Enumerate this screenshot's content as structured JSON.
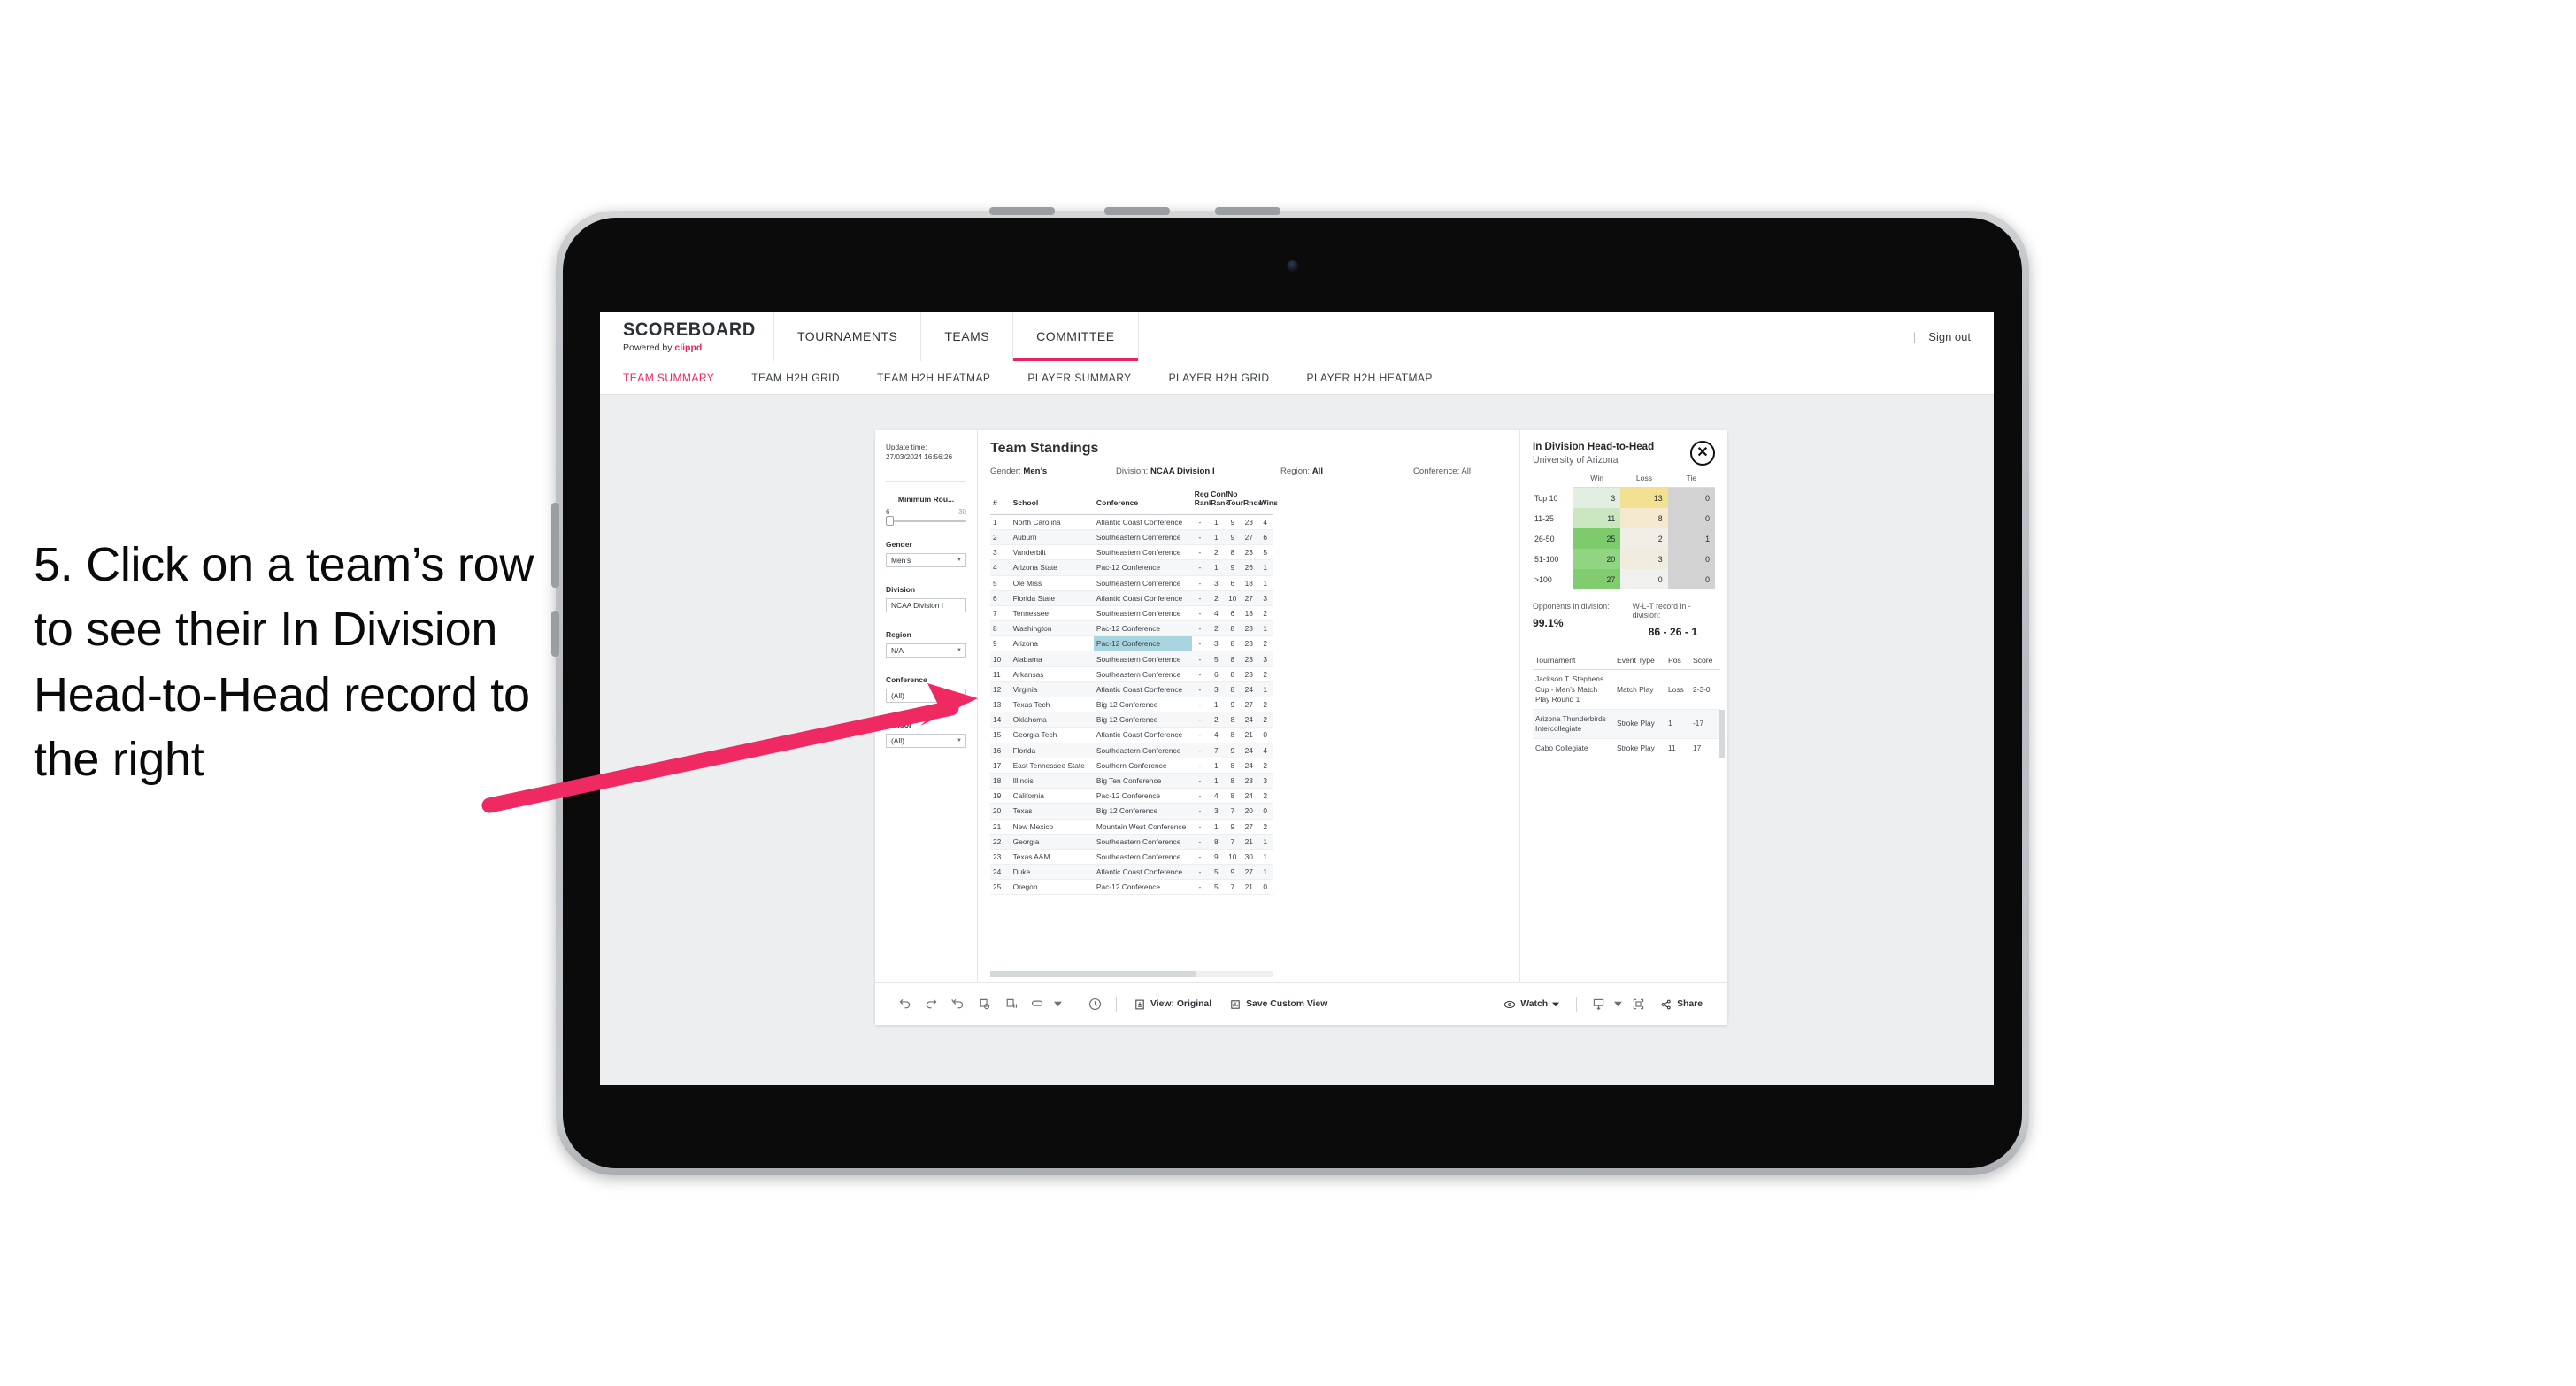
{
  "annotation": {
    "text": "5. Click on a team’s row to see their In Division Head-to-Head record to the right",
    "arrow_color": "#ef2a63"
  },
  "app": {
    "brand": {
      "title": "SCOREBOARD",
      "sub_prefix": "Powered by ",
      "sub_brand": "clippd"
    },
    "topnav": [
      {
        "label": "TOURNAMENTS",
        "active": false
      },
      {
        "label": "TEAMS",
        "active": false
      },
      {
        "label": "COMMITTEE",
        "active": true
      }
    ],
    "topbar_right": {
      "divider": "|",
      "sign_out": "Sign out"
    },
    "subnav": [
      {
        "label": "TEAM SUMMARY",
        "active": true
      },
      {
        "label": "TEAM H2H GRID",
        "active": false
      },
      {
        "label": "TEAM H2H HEATMAP",
        "active": false
      },
      {
        "label": "PLAYER SUMMARY",
        "active": false
      },
      {
        "label": "PLAYER H2H GRID",
        "active": false
      },
      {
        "label": "PLAYER H2H HEATMAP",
        "active": false
      }
    ],
    "accent_color": "#e8245c"
  },
  "filters": {
    "update_label": "Update time:",
    "update_value": "27/03/2024 16:56:26",
    "min_rounds": {
      "title": "Minimum Rou...",
      "min": "6",
      "max": "30"
    },
    "gender": {
      "title": "Gender",
      "value": "Men’s"
    },
    "division": {
      "title": "Division",
      "value": "NCAA Division I"
    },
    "region": {
      "title": "Region",
      "value": "N/A"
    },
    "conference": {
      "title": "Conference",
      "value": "(All)"
    },
    "school": {
      "title": "School",
      "value": "(All)"
    }
  },
  "standings": {
    "title": "Team Standings",
    "meta": {
      "gender_label": "Gender:",
      "gender_value": "Men’s",
      "division_label": "Division:",
      "division_value": "NCAA Division I",
      "region_label": "Region:",
      "region_value": "All",
      "conference_label": "Conference:",
      "conference_value": "All"
    },
    "columns": [
      "#",
      "School",
      "Conference",
      "Reg Rank",
      "Conf Rank",
      "No Tour",
      "Rnds",
      "Wins"
    ],
    "highlighted_row_index": 8,
    "rows": [
      {
        "rank": "1",
        "school": "North Carolina",
        "conference": "Atlantic Coast Conference",
        "reg_rank": "-",
        "conf_rank": "1",
        "no_tour": "9",
        "rnds": "23",
        "wins": "4"
      },
      {
        "rank": "2",
        "school": "Auburn",
        "conference": "Southeastern Conference",
        "reg_rank": "-",
        "conf_rank": "1",
        "no_tour": "9",
        "rnds": "27",
        "wins": "6"
      },
      {
        "rank": "3",
        "school": "Vanderbilt",
        "conference": "Southeastern Conference",
        "reg_rank": "-",
        "conf_rank": "2",
        "no_tour": "8",
        "rnds": "23",
        "wins": "5"
      },
      {
        "rank": "4",
        "school": "Arizona State",
        "conference": "Pac-12 Conference",
        "reg_rank": "-",
        "conf_rank": "1",
        "no_tour": "9",
        "rnds": "26",
        "wins": "1"
      },
      {
        "rank": "5",
        "school": "Ole Miss",
        "conference": "Southeastern Conference",
        "reg_rank": "-",
        "conf_rank": "3",
        "no_tour": "6",
        "rnds": "18",
        "wins": "1"
      },
      {
        "rank": "6",
        "school": "Florida State",
        "conference": "Atlantic Coast Conference",
        "reg_rank": "-",
        "conf_rank": "2",
        "no_tour": "10",
        "rnds": "27",
        "wins": "3"
      },
      {
        "rank": "7",
        "school": "Tennessee",
        "conference": "Southeastern Conference",
        "reg_rank": "-",
        "conf_rank": "4",
        "no_tour": "6",
        "rnds": "18",
        "wins": "2"
      },
      {
        "rank": "8",
        "school": "Washington",
        "conference": "Pac-12 Conference",
        "reg_rank": "-",
        "conf_rank": "2",
        "no_tour": "8",
        "rnds": "23",
        "wins": "1"
      },
      {
        "rank": "9",
        "school": "Arizona",
        "conference": "Pac-12 Conference",
        "reg_rank": "-",
        "conf_rank": "3",
        "no_tour": "8",
        "rnds": "23",
        "wins": "2"
      },
      {
        "rank": "10",
        "school": "Alabama",
        "conference": "Southeastern Conference",
        "reg_rank": "-",
        "conf_rank": "5",
        "no_tour": "8",
        "rnds": "23",
        "wins": "3"
      },
      {
        "rank": "11",
        "school": "Arkansas",
        "conference": "Southeastern Conference",
        "reg_rank": "-",
        "conf_rank": "6",
        "no_tour": "8",
        "rnds": "23",
        "wins": "2"
      },
      {
        "rank": "12",
        "school": "Virginia",
        "conference": "Atlantic Coast Conference",
        "reg_rank": "-",
        "conf_rank": "3",
        "no_tour": "8",
        "rnds": "24",
        "wins": "1"
      },
      {
        "rank": "13",
        "school": "Texas Tech",
        "conference": "Big 12 Conference",
        "reg_rank": "-",
        "conf_rank": "1",
        "no_tour": "9",
        "rnds": "27",
        "wins": "2"
      },
      {
        "rank": "14",
        "school": "Oklahoma",
        "conference": "Big 12 Conference",
        "reg_rank": "-",
        "conf_rank": "2",
        "no_tour": "8",
        "rnds": "24",
        "wins": "2"
      },
      {
        "rank": "15",
        "school": "Georgia Tech",
        "conference": "Atlantic Coast Conference",
        "reg_rank": "-",
        "conf_rank": "4",
        "no_tour": "8",
        "rnds": "21",
        "wins": "0"
      },
      {
        "rank": "16",
        "school": "Florida",
        "conference": "Southeastern Conference",
        "reg_rank": "-",
        "conf_rank": "7",
        "no_tour": "9",
        "rnds": "24",
        "wins": "4"
      },
      {
        "rank": "17",
        "school": "East Tennessee State",
        "conference": "Southern Conference",
        "reg_rank": "-",
        "conf_rank": "1",
        "no_tour": "8",
        "rnds": "24",
        "wins": "2"
      },
      {
        "rank": "18",
        "school": "Illinois",
        "conference": "Big Ten Conference",
        "reg_rank": "-",
        "conf_rank": "1",
        "no_tour": "8",
        "rnds": "23",
        "wins": "3"
      },
      {
        "rank": "19",
        "school": "California",
        "conference": "Pac-12 Conference",
        "reg_rank": "-",
        "conf_rank": "4",
        "no_tour": "8",
        "rnds": "24",
        "wins": "2"
      },
      {
        "rank": "20",
        "school": "Texas",
        "conference": "Big 12 Conference",
        "reg_rank": "-",
        "conf_rank": "3",
        "no_tour": "7",
        "rnds": "20",
        "wins": "0"
      },
      {
        "rank": "21",
        "school": "New Mexico",
        "conference": "Mountain West Conference",
        "reg_rank": "-",
        "conf_rank": "1",
        "no_tour": "9",
        "rnds": "27",
        "wins": "2"
      },
      {
        "rank": "22",
        "school": "Georgia",
        "conference": "Southeastern Conference",
        "reg_rank": "-",
        "conf_rank": "8",
        "no_tour": "7",
        "rnds": "21",
        "wins": "1"
      },
      {
        "rank": "23",
        "school": "Texas A&M",
        "conference": "Southeastern Conference",
        "reg_rank": "-",
        "conf_rank": "9",
        "no_tour": "10",
        "rnds": "30",
        "wins": "1"
      },
      {
        "rank": "24",
        "school": "Duke",
        "conference": "Atlantic Coast Conference",
        "reg_rank": "-",
        "conf_rank": "5",
        "no_tour": "9",
        "rnds": "27",
        "wins": "1"
      },
      {
        "rank": "25",
        "school": "Oregon",
        "conference": "Pac-12 Conference",
        "reg_rank": "-",
        "conf_rank": "5",
        "no_tour": "7",
        "rnds": "21",
        "wins": "0"
      }
    ]
  },
  "detail": {
    "title": "In Division Head-to-Head",
    "subtitle": "University of Arizona",
    "close_label": "✕",
    "chart_data": {
      "type": "heatmap",
      "title": "In Division Head-to-Head",
      "subtitle": "University of Arizona",
      "columns": [
        "Win",
        "Loss",
        "Tie"
      ],
      "categories": [
        "Top 10",
        "11-25",
        "26-50",
        "51-100",
        ">100"
      ],
      "series": [
        {
          "name": "Win",
          "values": [
            3,
            11,
            25,
            20,
            27
          ]
        },
        {
          "name": "Loss",
          "values": [
            13,
            8,
            2,
            3,
            0
          ]
        },
        {
          "name": "Tie",
          "values": [
            0,
            0,
            1,
            0,
            0
          ]
        }
      ],
      "cell_colors": {
        "win": [
          "#e2eee2",
          "#cbe7c2",
          "#7ecb6e",
          "#91d481",
          "#80cc6f"
        ],
        "loss": [
          "#f2e093",
          "#f5ead0",
          "#f0eee6",
          "#f1ece0",
          "#f0f0ee"
        ],
        "tie": [
          "#d2d2d2",
          "#d2d2d2",
          "#d2d2d2",
          "#d2d2d2",
          "#d2d2d2"
        ]
      }
    },
    "stats": {
      "opponents_label": "Opponents in division:",
      "opponents_value": "99.1%",
      "record_label": "W-L-T record in -division:",
      "record_value": "86 - 26 - 1"
    },
    "tournament_columns": [
      "Tournament",
      "Event Type",
      "Pos",
      "Score"
    ],
    "tournaments": [
      {
        "name": "Jackson T. Stephens Cup - Men’s Match Play Round 1",
        "type": "Match Play",
        "pos": "Loss",
        "score": "2-3-0"
      },
      {
        "name": "Arizona Thunderbirds Intercollegiate",
        "type": "Stroke Play",
        "pos": "1",
        "score": "-17"
      },
      {
        "name": "Cabo Collegiate",
        "type": "Stroke Play",
        "pos": "11",
        "score": "17"
      }
    ]
  },
  "toolbar": {
    "view_label": "View: Original",
    "save_label": "Save Custom View",
    "watch_label": "Watch",
    "share_label": "Share",
    "sep": "|"
  }
}
